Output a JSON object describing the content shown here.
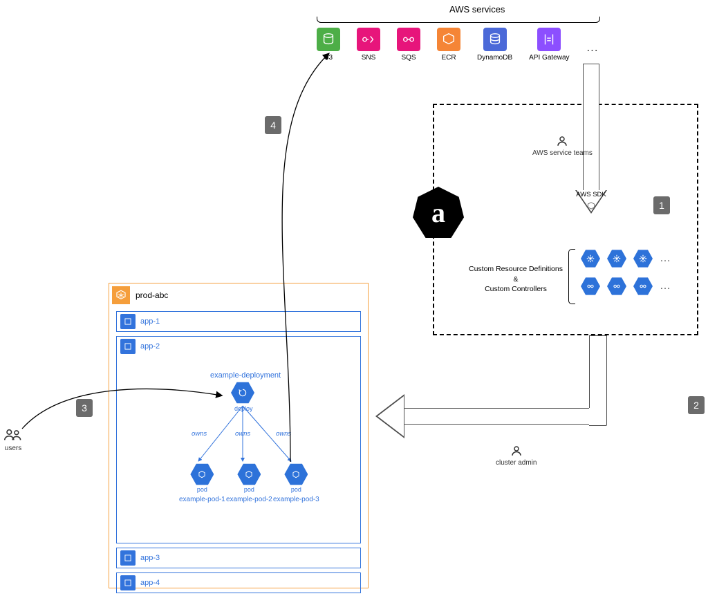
{
  "header": {
    "title": "AWS services"
  },
  "services": [
    {
      "name": "S3",
      "color": "s-green"
    },
    {
      "name": "SNS",
      "color": "s-pink"
    },
    {
      "name": "SQS",
      "color": "s-pink"
    },
    {
      "name": "ECR",
      "color": "s-orange"
    },
    {
      "name": "DynamoDB",
      "color": "s-blue"
    },
    {
      "name": "API Gateway",
      "color": "s-purple"
    }
  ],
  "ellipsis": "…",
  "aws_sdk_label": "AWS SDK",
  "aws_teams_label": "AWS service teams",
  "crd_label_line1": "Custom Resource Definitions",
  "crd_label_amp": "&",
  "crd_label_line2": "Custom Controllers",
  "cluster_admin_label": "cluster admin",
  "users_label": "users",
  "steps": {
    "s1": "1",
    "s2": "2",
    "s3": "3",
    "s4": "4"
  },
  "namespace": {
    "title": "prod-abc",
    "apps": [
      {
        "label": "app-1"
      },
      {
        "label": "app-2"
      },
      {
        "label": "app-3"
      },
      {
        "label": "app-4"
      }
    ]
  },
  "deployment": {
    "title": "example-deployment",
    "node_label": "deploy",
    "rel_label": "owns",
    "pods": [
      {
        "name": "example-pod-1"
      },
      {
        "name": "example-pod-2"
      },
      {
        "name": "example-pod-3"
      }
    ],
    "pod_node_label": "pod"
  },
  "a_logo": "a"
}
